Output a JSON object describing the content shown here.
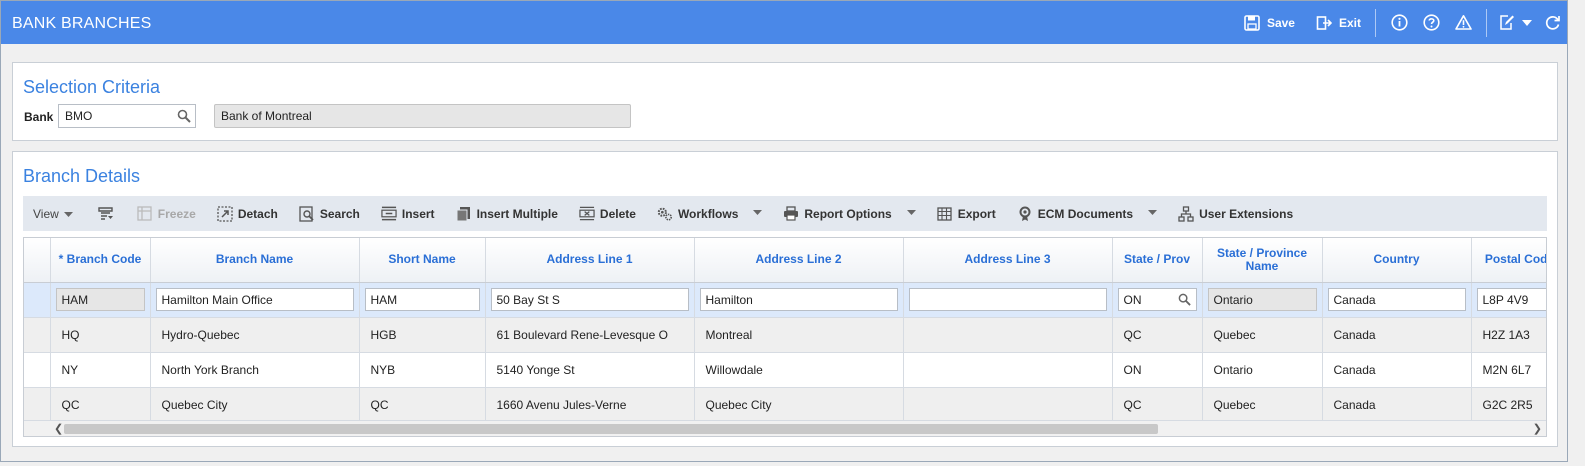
{
  "window": {
    "title": "BANK BRANCHES"
  },
  "titlebar": {
    "save_label": "Save",
    "exit_label": "Exit"
  },
  "selection": {
    "title": "Selection Criteria",
    "bank_label": "Bank",
    "bank_value": "BMO",
    "bank_name": "Bank of Montreal"
  },
  "details": {
    "title": "Branch Details",
    "toolbar": {
      "view": "View",
      "freeze": "Freeze",
      "detach": "Detach",
      "search": "Search",
      "insert": "Insert",
      "insert_multiple": "Insert Multiple",
      "delete": "Delete",
      "workflows": "Workflows",
      "report_options": "Report Options",
      "export": "Export",
      "ecm_documents": "ECM Documents",
      "user_extensions": "User Extensions"
    },
    "columns": [
      "* Branch Code",
      "Branch Name",
      "Short Name",
      "Address Line 1",
      "Address Line 2",
      "Address Line 3",
      "State / Prov",
      "State / Province Name",
      "Country",
      "Postal Code"
    ],
    "edit_row": {
      "code": "HAM",
      "name": "Hamilton Main Office",
      "short": "HAM",
      "addr1": "50 Bay St S",
      "addr2": "Hamilton",
      "addr3": "",
      "state": "ON",
      "state_name": "Ontario",
      "country": "Canada",
      "postal": "L8P 4V9"
    },
    "rows": [
      {
        "code": "HQ",
        "name": "Hydro-Quebec",
        "short": "HGB",
        "addr1": "61 Boulevard Rene-Levesque O",
        "addr2": "Montreal",
        "addr3": "",
        "state": "QC",
        "state_name": "Quebec",
        "country": "Canada",
        "postal": "H2Z 1A3"
      },
      {
        "code": "NY",
        "name": "North York Branch",
        "short": "NYB",
        "addr1": "5140 Yonge St",
        "addr2": "Willowdale",
        "addr3": "",
        "state": "ON",
        "state_name": "Ontario",
        "country": "Canada",
        "postal": "M2N 6L7"
      },
      {
        "code": "QC",
        "name": "Quebec City",
        "short": "QC",
        "addr1": "1660 Avenu Jules-Verne",
        "addr2": "Quebec City",
        "addr3": "",
        "state": "QC",
        "state_name": "Quebec",
        "country": "Canada",
        "postal": "G2C 2R5"
      }
    ]
  },
  "colors": {
    "accent": "#4a88e8",
    "title_blue": "#3b82e0",
    "header_text": "#2a6fd6",
    "edit_row": "#dce9fb"
  }
}
